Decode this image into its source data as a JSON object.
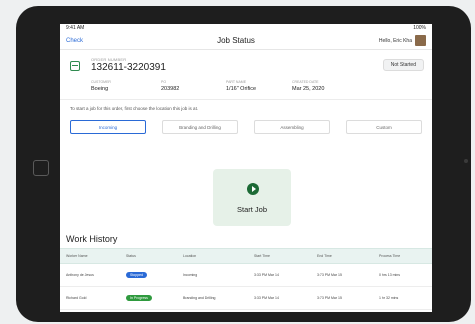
{
  "statusbar": {
    "left": "9:41 AM",
    "right": "100%"
  },
  "nav": {
    "back": "Check",
    "title": "Job Status",
    "user": "Hello, Eric Kha"
  },
  "order": {
    "label": "ORDER NUMBER",
    "number": "132611-3220391",
    "status": "Not Started",
    "meta": [
      {
        "key": "CUSTOMER",
        "value": "Boeing"
      },
      {
        "key": "PO",
        "value": "203982"
      },
      {
        "key": "PART NAME",
        "value": "1/16\" Orifice"
      },
      {
        "key": "CREATED DATE",
        "value": "Mar 25, 2020"
      }
    ]
  },
  "instruction": "To start a job for this order, first choose the location this job is at.",
  "locations": [
    "Incoming",
    "Branding and Drilling",
    "Assembling",
    "Custom"
  ],
  "start": {
    "label": "Start Job"
  },
  "work_history": {
    "title": "Work History",
    "columns": [
      "Worker Name",
      "Status",
      "Location",
      "Start Time",
      "End Time",
      "Process Time"
    ],
    "rows": [
      {
        "worker": "Anthony de Jesus",
        "status": "Stopped",
        "location": "Incoming",
        "start": "3:33 PM Mar 14",
        "end": "3:73 PM Mar 15",
        "process": "0 hrs 13 mins"
      },
      {
        "worker": "Richard Gold",
        "status": "In Progress",
        "location": "Branding and Drilling",
        "start": "3:33 PM Mar 14",
        "end": "3:73 PM Mar 15",
        "process": "1 hr 32 mins"
      }
    ]
  },
  "colors": {
    "accent": "#2a6ad6",
    "success": "#2f9a3e",
    "start_card": "#e6f1e8",
    "table_header": "#e9f3f1"
  }
}
